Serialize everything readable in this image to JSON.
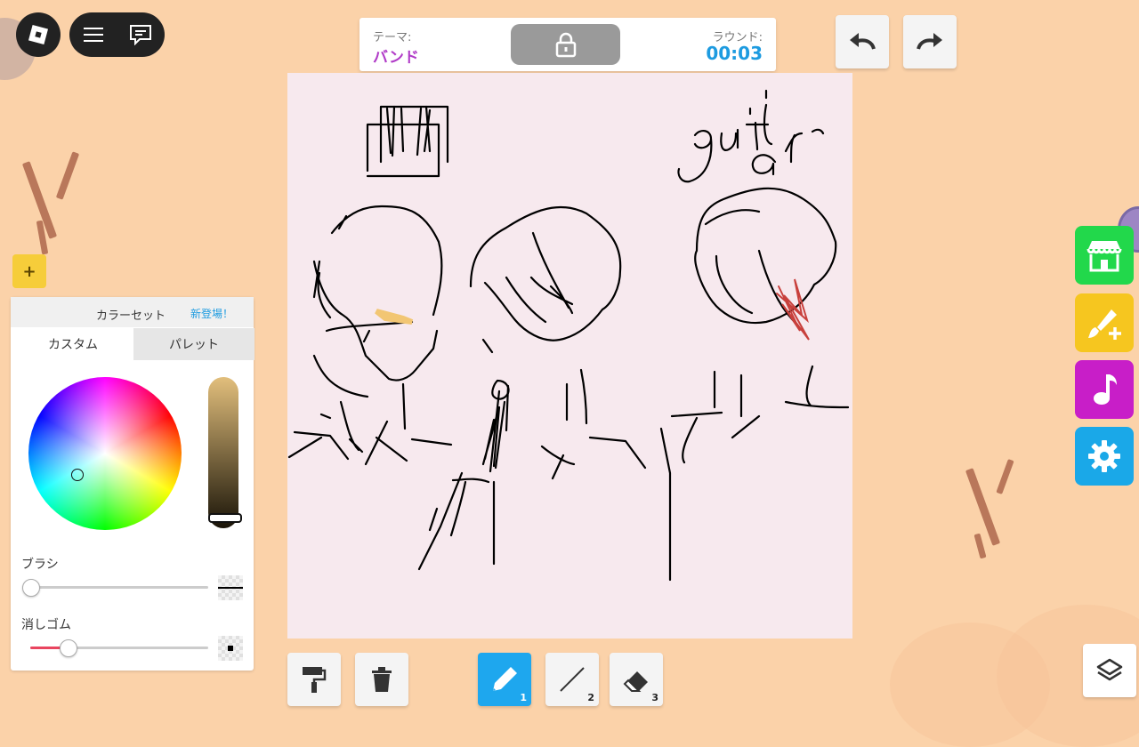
{
  "theme_bar": {
    "theme_label": "テーマ:",
    "theme_value": "バンド",
    "round_label": "ラウンド:",
    "round_time": "00:03"
  },
  "color_panel": {
    "header_title": "カラーセット",
    "header_new": "新登場！",
    "tabs": [
      "カスタム",
      "パレット"
    ],
    "brush_label": "ブラシ",
    "eraser_label": "消しゴム",
    "add_label": "+",
    "shade_level": 0.9,
    "brush_size": 0.0,
    "eraser_size": 0.26
  },
  "toolbar": {
    "pencil_num": "1",
    "line_num": "2",
    "eraser_num": "3"
  },
  "canvas_text": "guit ar",
  "colors": {
    "background": "#fbd2a9",
    "canvas": "#f7e9ee",
    "accent_blue": "#1ea7ee",
    "theme_purple": "#b13cc8",
    "shop_green": "#22d84b",
    "brush_yellow": "#f6c61f",
    "music_magenta": "#c81ec8",
    "settings_blue": "#1aa8e8"
  },
  "icons": [
    "roblox-logo-icon",
    "menu-icon",
    "chat-icon",
    "lock-icon",
    "undo-icon",
    "redo-icon",
    "paint-roller-icon",
    "trash-icon",
    "pencil-icon",
    "line-icon",
    "eraser-icon",
    "shop-icon",
    "brush-plus-icon",
    "music-note-icon",
    "gear-icon",
    "layers-icon"
  ]
}
